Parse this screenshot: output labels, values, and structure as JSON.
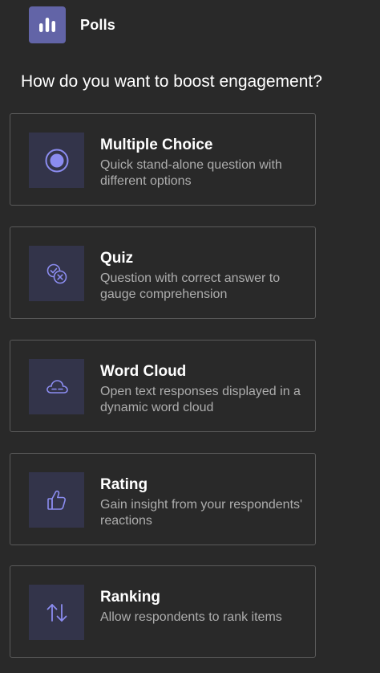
{
  "app": {
    "title": "Polls",
    "icon": "poll-bar-chart-icon"
  },
  "question": "How do you want to boost engagement?",
  "colors": {
    "background": "#292929",
    "accent": "#6264a7",
    "icon_tile": "#33344a",
    "icon_stroke": "#8b8cf0",
    "card_border": "#5a5a5a",
    "description": "#adadad"
  },
  "options": [
    {
      "title": "Multiple Choice",
      "description": "Quick stand-alone question with different options",
      "icon": "radio-button-icon"
    },
    {
      "title": "Quiz",
      "description": "Question with correct answer to gauge comprehension",
      "icon": "check-x-circles-icon"
    },
    {
      "title": "Word Cloud",
      "description": "Open text responses displayed in a dynamic word cloud",
      "icon": "cloud-icon"
    },
    {
      "title": "Rating",
      "description": "Gain insight from your respondents' reactions",
      "icon": "thumbs-up-icon"
    },
    {
      "title": "Ranking",
      "description": "Allow respondents to rank items",
      "icon": "arrow-up-down-icon"
    }
  ]
}
